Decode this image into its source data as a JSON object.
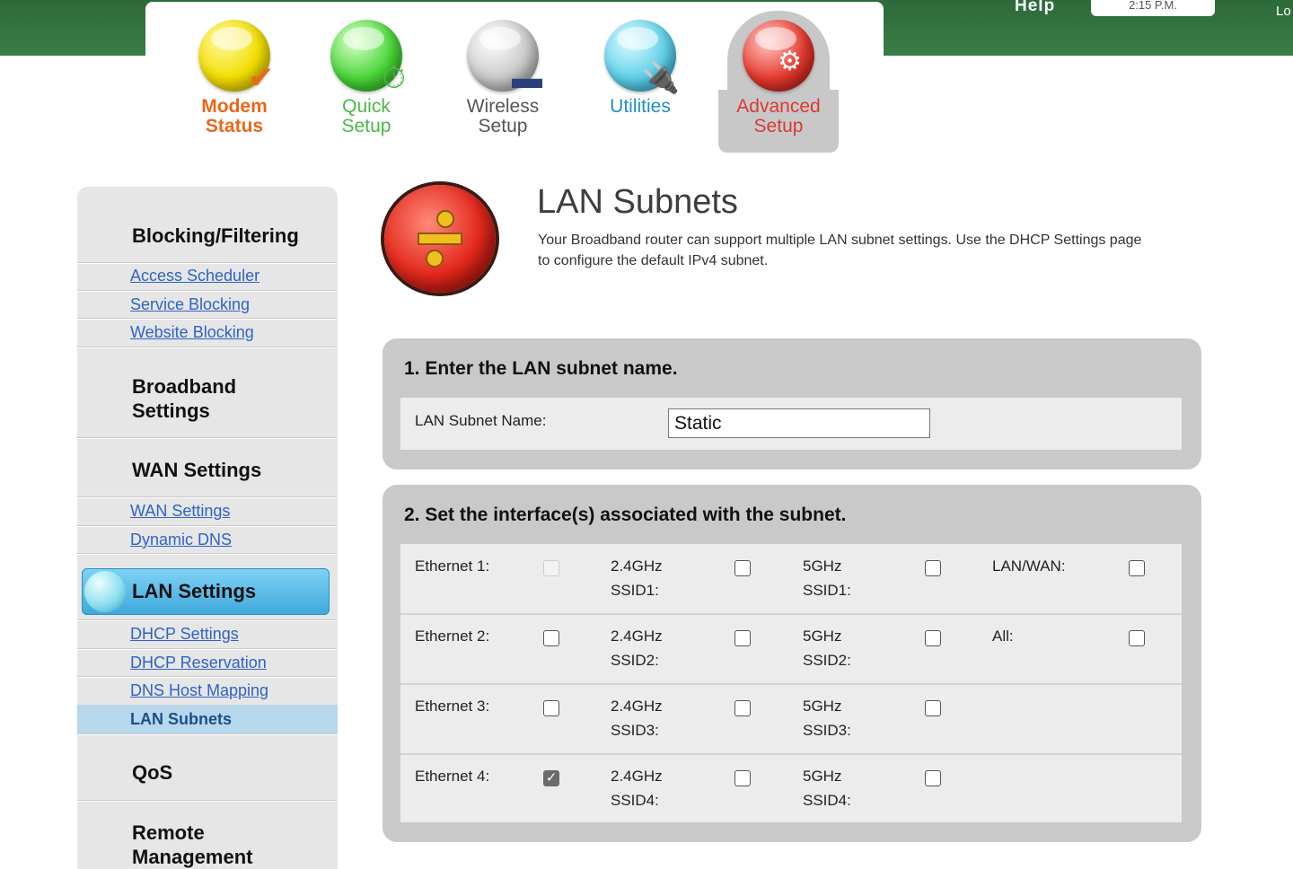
{
  "header": {
    "help_label": "Help",
    "time": "2:15 P.M.",
    "logout_label": "Lo"
  },
  "tabs": [
    {
      "line1": "Modem",
      "line2": "Status"
    },
    {
      "line1": "Quick",
      "line2": "Setup"
    },
    {
      "line1": "Wireless",
      "line2": "Setup"
    },
    {
      "line1": "Utilities",
      "line2": ""
    },
    {
      "line1": "Advanced",
      "line2": "Setup"
    }
  ],
  "sidebar": {
    "blocking_title": "Blocking/Filtering",
    "blocking_links": [
      "Access Scheduler",
      "Service Blocking",
      "Website Blocking"
    ],
    "broadband_title_1": "Broadband",
    "broadband_title_2": "Settings",
    "wan_title": "WAN Settings",
    "wan_links": [
      "WAN Settings",
      "Dynamic DNS"
    ],
    "lan_title": "LAN Settings",
    "lan_links": [
      "DHCP Settings",
      "DHCP Reservation",
      "DNS Host Mapping"
    ],
    "lan_current": "LAN Subnets",
    "qos_title": "QoS",
    "remote_title_1": "Remote",
    "remote_title_2": "Management"
  },
  "main": {
    "title": "LAN Subnets",
    "description": "Your Broadband router can support multiple LAN subnet settings. Use the DHCP Settings page to configure the default IPv4 subnet."
  },
  "section1": {
    "title": "1. Enter the LAN subnet name.",
    "field_label": "LAN Subnet Name:",
    "field_value": "Static"
  },
  "section2": {
    "title": "2. Set the interface(s) associated with the subnet.",
    "rows": [
      {
        "eth": "Ethernet 1:",
        "eth_state": "disabled",
        "g24_1": "2.4GHz",
        "g24_2": "SSID1:",
        "g5_1": "5GHz",
        "g5_2": "SSID1:",
        "extra": "LAN/WAN:"
      },
      {
        "eth": "Ethernet 2:",
        "eth_state": "unchecked",
        "g24_1": "2.4GHz",
        "g24_2": "SSID2:",
        "g5_1": "5GHz",
        "g5_2": "SSID2:",
        "extra": "All:"
      },
      {
        "eth": "Ethernet 3:",
        "eth_state": "unchecked",
        "g24_1": "2.4GHz",
        "g24_2": "SSID3:",
        "g5_1": "5GHz",
        "g5_2": "SSID3:",
        "extra": ""
      },
      {
        "eth": "Ethernet 4:",
        "eth_state": "checked",
        "g24_1": "2.4GHz",
        "g24_2": "SSID4:",
        "g5_1": "5GHz",
        "g5_2": "SSID4:",
        "extra": ""
      }
    ]
  },
  "colors": {
    "header_green": "#3a7d46",
    "link_blue": "#2f63c8",
    "active_blue": "#3fa8dc",
    "panel_gray": "#c9c9c9"
  }
}
